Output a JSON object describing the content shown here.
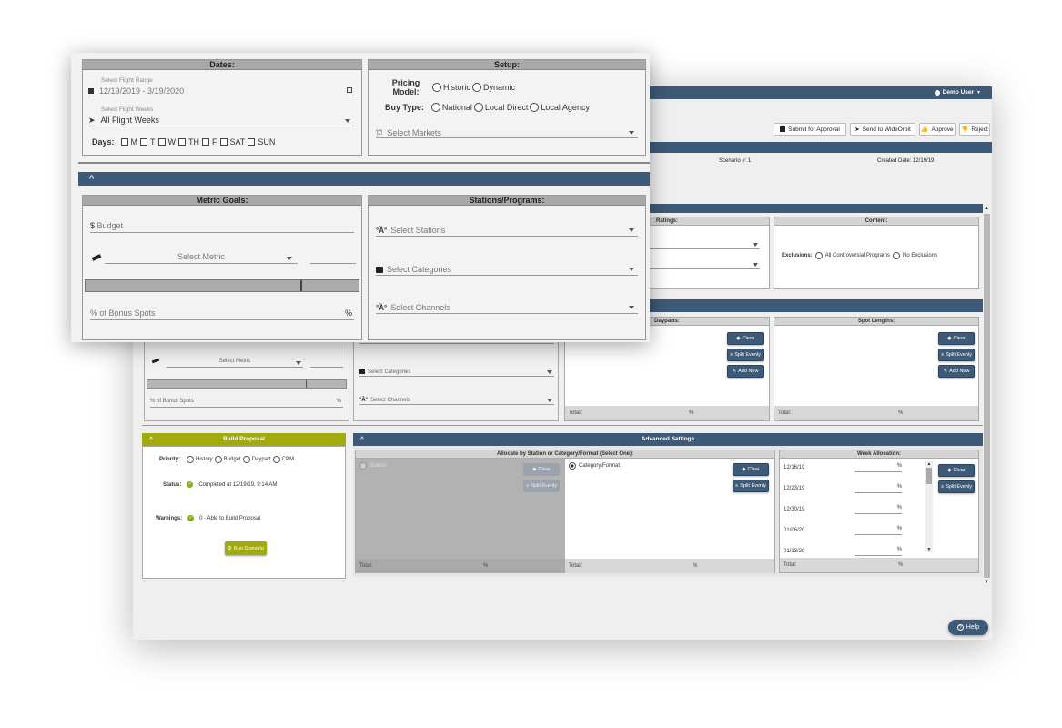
{
  "colors": {
    "navy": "#3d5a78",
    "olive": "#a1ab0e",
    "success": "#7fb315"
  },
  "topbar": {
    "user": "Demo User"
  },
  "toolbar": {
    "submit": "Submit for Approval",
    "send": "Send to WideOrbit",
    "approve": "Approve",
    "reject": "Reject"
  },
  "info": {
    "scenario": "Scenario #: 1",
    "created": "Created Date: 12/19/19"
  },
  "ratings": {
    "title": "Ratings:"
  },
  "content": {
    "title": "Content:",
    "exclusions_label": "Exclusions:",
    "opt1": "All Controversial Programs",
    "opt2": "No Exclusions"
  },
  "dayparts": {
    "title": "Dayparts:",
    "clear": "Clear",
    "split": "Split Evenly",
    "add": "Add New",
    "total": "Total:",
    "pct": "%"
  },
  "spotlengths": {
    "title": "Spot Lengths:",
    "clear": "Clear",
    "split": "Split Evenly",
    "add": "Add New",
    "total": "Total:",
    "pct": "%"
  },
  "back_goals": {
    "select_metric": "Select Metric",
    "bonus": "% of Bonus Spots",
    "pct": "%",
    "select_stations": "Select Stations",
    "select_categories": "Select Categories",
    "select_channels": "Select Channels"
  },
  "build": {
    "title": "Build Proposal",
    "priority_label": "Priority:",
    "p1": "History",
    "p2": "Budget",
    "p3": "Daypart",
    "p4": "CPM",
    "status_label": "Status:",
    "status": "Completed at 12/19/19, 9:14 AM",
    "warnings_label": "Warnings:",
    "warnings": "0 - Able to Build Proposal",
    "run": "Run Scenario"
  },
  "advanced": {
    "title": "Advanced Settings",
    "allocate_title": "Allocate by Station or Category/Format (Select One):",
    "station": "Station",
    "catformat": "Category/Format",
    "clear": "Clear",
    "split": "Split Evenly",
    "total": "Total:",
    "pct": "%"
  },
  "week": {
    "title": "Week Allocation:",
    "weeks": [
      "12/16/19",
      "12/23/19",
      "12/30/19",
      "01/06/20",
      "01/13/20"
    ],
    "pct": "%",
    "total": "Total:",
    "clear": "Clear",
    "split": "Split Evenly"
  },
  "help": "Help",
  "front": {
    "dates_title": "Dates:",
    "flight_range_label": "Select Flight Range",
    "flight_range": "12/19/2019 - 3/19/2020",
    "flight_weeks_label": "Select Flight Weeks",
    "flight_weeks": "All Flight Weeks",
    "days_label": "Days:",
    "days": [
      "M",
      "T",
      "W",
      "TH",
      "F",
      "SAT",
      "SUN"
    ],
    "setup_title": "Setup:",
    "pricing_label": "Pricing Model:",
    "pricing1": "Historic",
    "pricing2": "Dynamic",
    "buytype_label": "Buy Type:",
    "buy1": "National",
    "buy2": "Local Direct",
    "buy3": "Local Agency",
    "markets": "Select Markets",
    "metric_title": "Metric Goals:",
    "budget": "Budget",
    "dollar": "$",
    "select_metric": "Select Metric",
    "bonus": "% of Bonus Spots",
    "pct": "%",
    "stations_title": "Stations/Programs:",
    "stations": "Select Stations",
    "categories": "Select Categories",
    "channels": "Select Channels"
  }
}
